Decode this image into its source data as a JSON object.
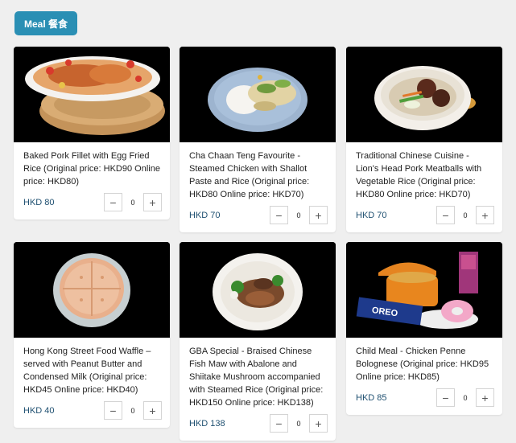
{
  "tab": {
    "label": "Meal 餐食"
  },
  "items": [
    {
      "title": "Baked Pork Fillet with Egg Fried Rice (Original price: HKD90 Online price: HKD80)",
      "price": "HKD 80",
      "qty": "0"
    },
    {
      "title": "Cha Chaan Teng Favourite - Steamed Chicken with Shallot Paste and Rice (Original price: HKD80 Online price: HKD70)",
      "price": "HKD 70",
      "qty": "0"
    },
    {
      "title": "Traditional Chinese Cuisine - Lion's Head Pork Meatballs with Vegetable Rice (Original price: HKD80 Online price: HKD70)",
      "price": "HKD 70",
      "qty": "0"
    },
    {
      "title": "Hong Kong Street Food Waffle – served with Peanut Butter and Condensed Milk (Original price: HKD45 Online price: HKD40)",
      "price": "HKD 40",
      "qty": "0"
    },
    {
      "title": "GBA Special - Braised Chinese Fish Maw with Abalone and Shiitake Mushroom accompanied with Steamed Rice (Original price: HKD150 Online price: HKD138)",
      "price": "HKD 138",
      "qty": "0"
    },
    {
      "title": "Child Meal - Chicken Penne Bolognese (Original price: HKD95 Online price: HKD85)",
      "price": "HKD 85",
      "qty": "0"
    }
  ],
  "stepper": {
    "minus": "−",
    "plus": "+"
  },
  "image_text": {
    "oreo": "OREO"
  }
}
